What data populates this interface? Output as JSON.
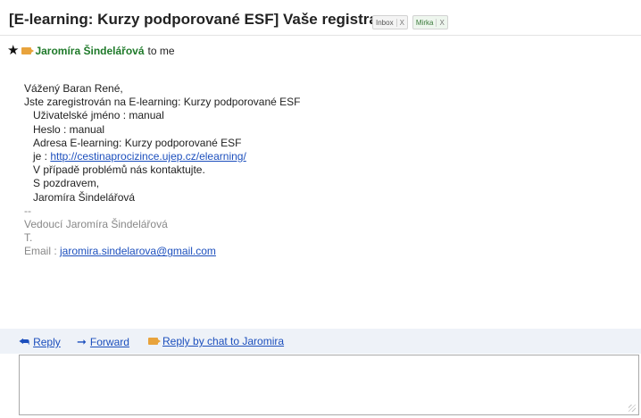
{
  "email": {
    "subject": "[E-learning: Kurzy podporované ESF] Vaše registrace",
    "labels": [
      {
        "text": "Inbox",
        "close": "X"
      },
      {
        "text": "Mirka",
        "close": "X"
      }
    ],
    "sender": "Jaromíra Šindelářová",
    "recipient": "to me",
    "body": {
      "greeting": "Vážený Baran René,",
      "line1": "Jste zaregistrován na E-learning: Kurzy podporované ESF",
      "username": "Uživatelské jméno :  manual",
      "password": "Heslo  : manual",
      "address": "Adresa E-learning: Kurzy podporované ESF",
      "url_prefix": "je : ",
      "url": "http://cestinaprocizince.ujep.cz/elearning/",
      "problems": "V případě problémů nás kontaktujte.",
      "regards": "S pozdravem,",
      "signature_name": "Jaromíra Šindelářová",
      "sig_sep": "--",
      "sig_title": "Vedoucí Jaromíra Šindelářová",
      "sig_t": "T.",
      "sig_email_label": "Email : ",
      "sig_email": "jaromira.sindelarova@gmail.com"
    }
  },
  "actions": {
    "reply": "Reply",
    "forward": "Forward",
    "chat": "Reply by chat to Jaromira"
  },
  "colors": {
    "sender": "#1f7a2a",
    "link": "#1c4fbd",
    "reply_bar_bg": "#eef2f8"
  }
}
